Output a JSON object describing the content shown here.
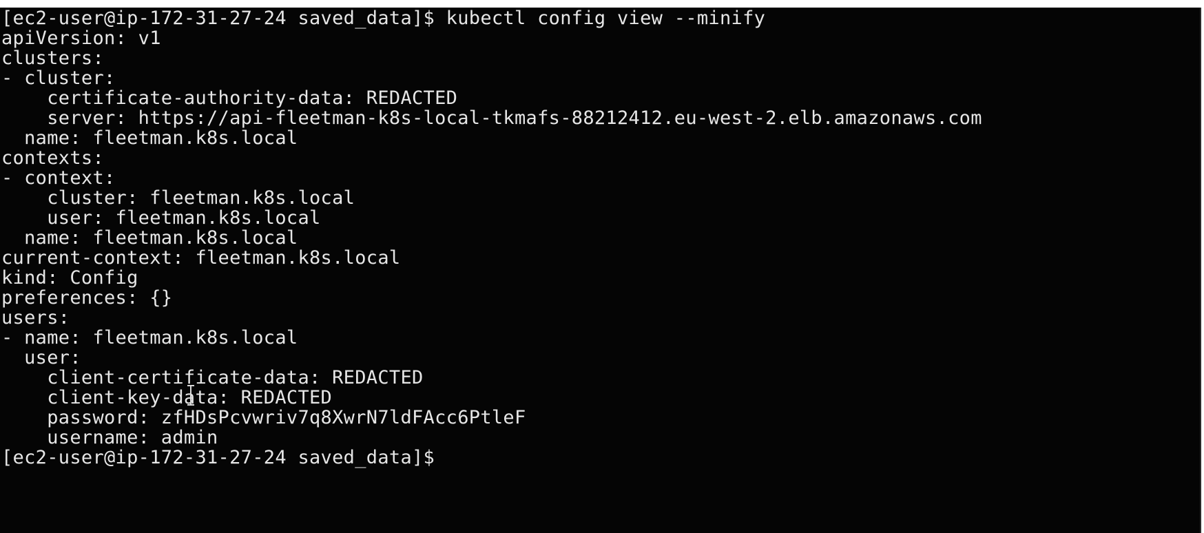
{
  "terminal": {
    "prompt_line": "[ec2-user@ip-172-31-27-24 saved_data]$ kubectl config view --minify",
    "output": [
      "apiVersion: v1",
      "clusters:",
      "- cluster:",
      "    certificate-authority-data: REDACTED",
      "    server: https://api-fleetman-k8s-local-tkmafs-88212412.eu-west-2.elb.amazonaws.com",
      "  name: fleetman.k8s.local",
      "contexts:",
      "- context:",
      "    cluster: fleetman.k8s.local",
      "    user: fleetman.k8s.local",
      "  name: fleetman.k8s.local",
      "current-context: fleetman.k8s.local",
      "kind: Config",
      "preferences: {}",
      "users:",
      "- name: fleetman.k8s.local",
      "  user:",
      "    client-certificate-data: REDACTED",
      "    client-key-data: REDACTED",
      "    password: zfHDsPcvwriv7q8XwrN7ldFAcc6PtleF",
      "    username: admin"
    ],
    "final_prompt": "[ec2-user@ip-172-31-27-24 saved_data]$ "
  },
  "colors": {
    "background": "#050505",
    "foreground": "#e6e6e6"
  },
  "icons": {
    "mouse_cursor": "text-ibeam-cursor-icon"
  }
}
